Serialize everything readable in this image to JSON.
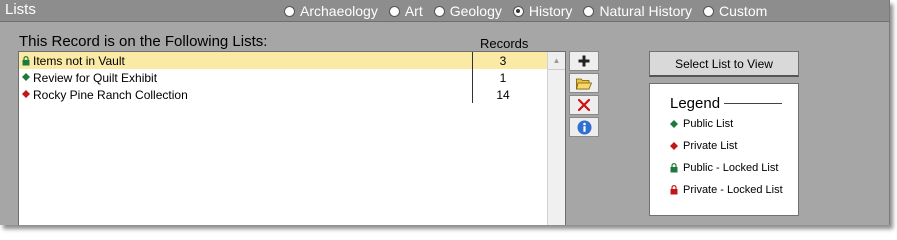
{
  "header": {
    "title": "Lists",
    "disciplines": [
      {
        "label": "Archaeology",
        "selected": false
      },
      {
        "label": "Art",
        "selected": false
      },
      {
        "label": "Geology",
        "selected": false
      },
      {
        "label": "History",
        "selected": true
      },
      {
        "label": "Natural History",
        "selected": false
      },
      {
        "label": "Custom",
        "selected": false
      }
    ]
  },
  "lists_panel": {
    "heading": "This Record is on the Following Lists:",
    "records_column": "Records",
    "rows": [
      {
        "name": "Items not in Vault",
        "records": "3",
        "icon": "green-lock-icon",
        "selected": true
      },
      {
        "name": "Review for Quilt Exhibit",
        "records": "1",
        "icon": "green-diamond-icon",
        "selected": false
      },
      {
        "name": "Rocky Pine Ranch Collection",
        "records": "14",
        "icon": "red-diamond-icon",
        "selected": false
      }
    ]
  },
  "toolbar": {
    "buttons": [
      {
        "icon": "plus-icon"
      },
      {
        "icon": "open-folder-icon"
      },
      {
        "icon": "red-x-icon"
      },
      {
        "icon": "info-icon"
      }
    ]
  },
  "select_button": {
    "label": "Select List to View"
  },
  "legend": {
    "title": "Legend",
    "items": [
      {
        "label": "Public List",
        "icon": "green-diamond-icon"
      },
      {
        "label": "Private List",
        "icon": "red-diamond-icon"
      },
      {
        "label": "Public - Locked List",
        "icon": "green-lock-icon"
      },
      {
        "label": "Private - Locked List",
        "icon": "red-lock-icon"
      }
    ]
  },
  "colors": {
    "public": "#1e7a3a",
    "private": "#c01818",
    "selected_row": "#fbe9a6",
    "panel_bg": "#a6a6a6",
    "title_bar": "#8d8d8d"
  }
}
